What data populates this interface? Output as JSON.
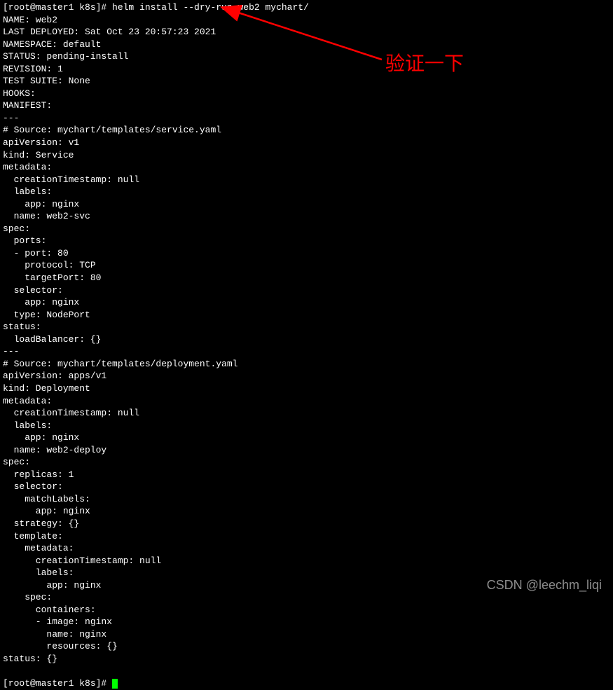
{
  "prompt1": "[root@master1 k8s]# ",
  "command": "helm install --dry-run web2 mychart/",
  "output": "NAME: web2\nLAST DEPLOYED: Sat Oct 23 20:57:23 2021\nNAMESPACE: default\nSTATUS: pending-install\nREVISION: 1\nTEST SUITE: None\nHOOKS:\nMANIFEST:\n---\n# Source: mychart/templates/service.yaml\napiVersion: v1\nkind: Service\nmetadata:\n  creationTimestamp: null\n  labels:\n    app: nginx\n  name: web2-svc\nspec:\n  ports:\n  - port: 80\n    protocol: TCP\n    targetPort: 80\n  selector:\n    app: nginx\n  type: NodePort\nstatus:\n  loadBalancer: {}\n---\n# Source: mychart/templates/deployment.yaml\napiVersion: apps/v1\nkind: Deployment\nmetadata:\n  creationTimestamp: null\n  labels:\n    app: nginx\n  name: web2-deploy\nspec:\n  replicas: 1\n  selector:\n    matchLabels:\n      app: nginx\n  strategy: {}\n  template:\n    metadata:\n      creationTimestamp: null\n      labels:\n        app: nginx\n    spec:\n      containers:\n      - image: nginx\n        name: nginx\n        resources: {}\nstatus: {}\n",
  "prompt2": "[root@master1 k8s]# ",
  "annotation": "验证一下",
  "watermark": "CSDN @leechm_liqi"
}
